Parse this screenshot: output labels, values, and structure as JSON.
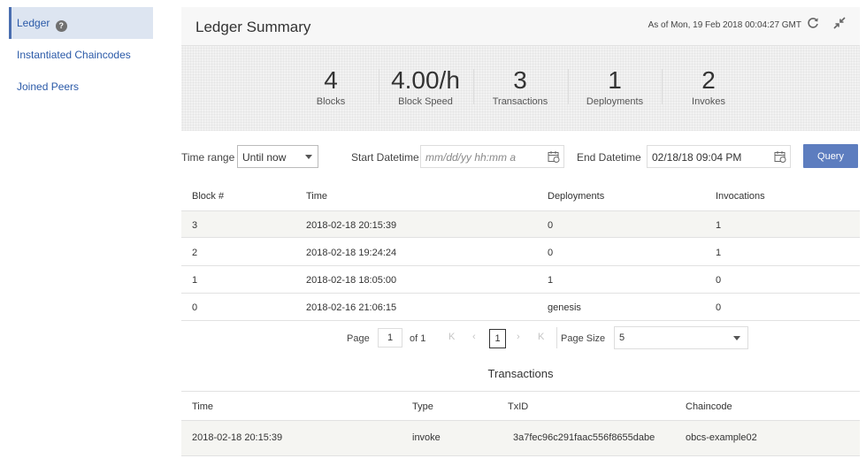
{
  "sidebar": {
    "items": [
      {
        "label": "Ledger"
      },
      {
        "label": "Instantiated Chaincodes"
      },
      {
        "label": "Joined Peers"
      }
    ],
    "help_glyph": "?"
  },
  "summary": {
    "title": "Ledger Summary",
    "as_of": "As of Mon, 19 Feb 2018 00:04:27 GMT",
    "stats": [
      {
        "value": "4",
        "label": "Blocks"
      },
      {
        "value": "4.00/h",
        "label": "Block Speed"
      },
      {
        "value": "3",
        "label": "Transactions"
      },
      {
        "value": "1",
        "label": "Deployments"
      },
      {
        "value": "2",
        "label": "Invokes"
      }
    ]
  },
  "filters": {
    "time_range_label": "Time range",
    "time_range_value": "Until now",
    "start_label": "Start Datetime",
    "start_placeholder": "mm/dd/yy hh:mm a",
    "end_label": "End Datetime",
    "end_value": "02/18/18 09:04 PM",
    "query_label": "Query"
  },
  "blocks": {
    "headers": [
      "Block #",
      "Time",
      "Deployments",
      "Invocations"
    ],
    "rows": [
      [
        "3",
        "2018-02-18 20:15:39",
        "0",
        "1"
      ],
      [
        "2",
        "2018-02-18 19:24:24",
        "0",
        "1"
      ],
      [
        "1",
        "2018-02-18 18:05:00",
        "1",
        "0"
      ],
      [
        "0",
        "2018-02-16 21:06:15",
        "genesis",
        "0"
      ]
    ]
  },
  "pager": {
    "page_label": "Page",
    "page_value": "1",
    "of_label": "of 1",
    "first": "K",
    "prev": "‹",
    "current": "1",
    "next": "›",
    "last": "K",
    "size_label": "Page Size",
    "size_value": "5"
  },
  "transactions": {
    "title": "Transactions",
    "headers": [
      "Time",
      "Type",
      "TxID",
      "Chaincode"
    ],
    "rows": [
      [
        "2018-02-18 20:15:39",
        "invoke",
        "3a7fec96c291faac556f8655dabe",
        "obcs-example02"
      ]
    ]
  },
  "icons": [
    "help-icon",
    "refresh-icon",
    "collapse-icon",
    "calendar-icon",
    "chevron-down-icon"
  ],
  "colors": {
    "accent": "#5d7dbf",
    "link": "#2b5aa8",
    "active_bg": "#dde5f1"
  }
}
